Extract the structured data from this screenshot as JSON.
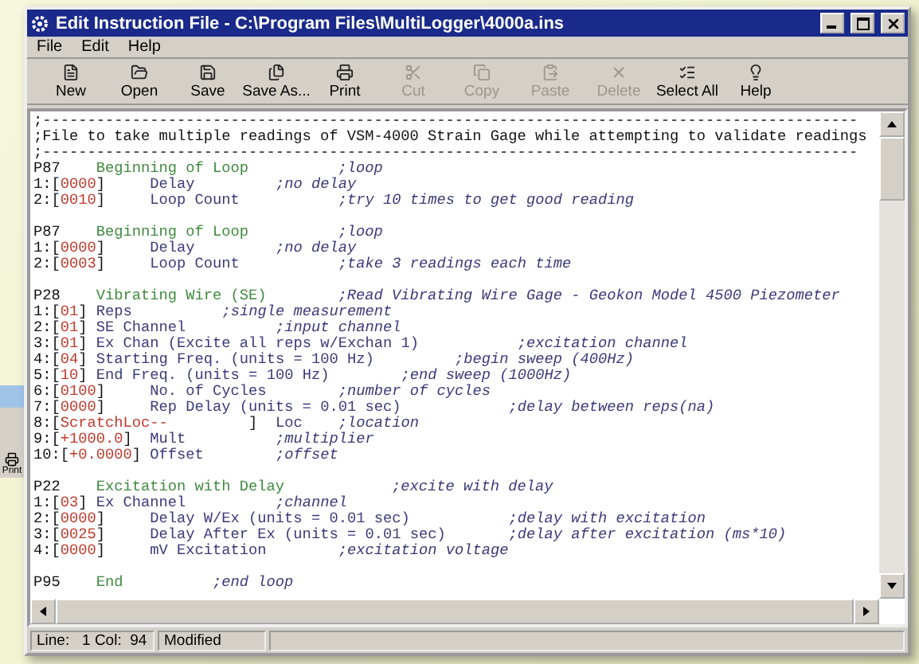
{
  "background_window": {
    "label": "Print"
  },
  "window": {
    "title": "Edit Instruction File - C:\\Program Files\\MultiLogger\\4000a.ins"
  },
  "menu": [
    "File",
    "Edit",
    "Help"
  ],
  "toolbar": [
    {
      "label": "New",
      "disabled": false
    },
    {
      "label": "Open",
      "disabled": false
    },
    {
      "label": "Save",
      "disabled": false
    },
    {
      "label": "Save As...",
      "disabled": false
    },
    {
      "label": "Print",
      "disabled": false
    },
    {
      "label": "Cut",
      "disabled": true
    },
    {
      "label": "Copy",
      "disabled": true
    },
    {
      "label": "Paste",
      "disabled": true
    },
    {
      "label": "Delete",
      "disabled": true
    },
    {
      "label": "Select All",
      "disabled": false
    },
    {
      "label": "Help",
      "disabled": false
    }
  ],
  "editor": {
    "lines": [
      {
        "kind": "code",
        "segments": [
          {
            "kind": "plain",
            "text": ";-------------------------------------------------------------------------------------------"
          }
        ]
      },
      {
        "kind": "code",
        "segments": [
          {
            "kind": "plain",
            "text": ";File to take multiple readings of VSM-4000 Strain Gage while attempting to validate readings"
          }
        ]
      },
      {
        "kind": "code",
        "segments": [
          {
            "kind": "plain",
            "text": ";-------------------------------------------------------------------------------------------"
          }
        ]
      },
      {
        "kind": "code",
        "segments": [
          {
            "kind": "plain",
            "text": "P87    "
          },
          {
            "kind": "title",
            "text": "Beginning of Loop          "
          },
          {
            "kind": "comment",
            "text": ";loop"
          }
        ]
      },
      {
        "kind": "code",
        "segments": [
          {
            "kind": "plain",
            "text": "1:["
          },
          {
            "kind": "value",
            "text": "0000"
          },
          {
            "kind": "plain",
            "text": "]     "
          },
          {
            "kind": "label",
            "text": "Delay         "
          },
          {
            "kind": "comment",
            "text": ";no delay"
          }
        ]
      },
      {
        "kind": "code",
        "segments": [
          {
            "kind": "plain",
            "text": "2:["
          },
          {
            "kind": "value",
            "text": "0010"
          },
          {
            "kind": "plain",
            "text": "]     "
          },
          {
            "kind": "label",
            "text": "Loop Count           "
          },
          {
            "kind": "comment",
            "text": ";try 10 times to get good reading"
          }
        ]
      },
      {
        "kind": "blank"
      },
      {
        "kind": "code",
        "segments": [
          {
            "kind": "plain",
            "text": "P87    "
          },
          {
            "kind": "title",
            "text": "Beginning of Loop          "
          },
          {
            "kind": "comment",
            "text": ";loop"
          }
        ]
      },
      {
        "kind": "code",
        "segments": [
          {
            "kind": "plain",
            "text": "1:["
          },
          {
            "kind": "value",
            "text": "0000"
          },
          {
            "kind": "plain",
            "text": "]     "
          },
          {
            "kind": "label",
            "text": "Delay         "
          },
          {
            "kind": "comment",
            "text": ";no delay"
          }
        ]
      },
      {
        "kind": "code",
        "segments": [
          {
            "kind": "plain",
            "text": "2:["
          },
          {
            "kind": "value",
            "text": "0003"
          },
          {
            "kind": "plain",
            "text": "]     "
          },
          {
            "kind": "label",
            "text": "Loop Count           "
          },
          {
            "kind": "comment",
            "text": ";take 3 readings each time"
          }
        ]
      },
      {
        "kind": "blank"
      },
      {
        "kind": "code",
        "segments": [
          {
            "kind": "plain",
            "text": "P28    "
          },
          {
            "kind": "title",
            "text": "Vibrating Wire (SE)        "
          },
          {
            "kind": "comment",
            "text": ";Read Vibrating Wire Gage - Geokon Model 4500 Piezometer"
          }
        ]
      },
      {
        "kind": "code",
        "segments": [
          {
            "kind": "plain",
            "text": "1:["
          },
          {
            "kind": "value",
            "text": "01"
          },
          {
            "kind": "plain",
            "text": "] "
          },
          {
            "kind": "label",
            "text": "Reps          "
          },
          {
            "kind": "comment",
            "text": ";single measurement"
          }
        ]
      },
      {
        "kind": "code",
        "segments": [
          {
            "kind": "plain",
            "text": "2:["
          },
          {
            "kind": "value",
            "text": "01"
          },
          {
            "kind": "plain",
            "text": "] "
          },
          {
            "kind": "label",
            "text": "SE Channel          "
          },
          {
            "kind": "comment",
            "text": ";input channel"
          }
        ]
      },
      {
        "kind": "code",
        "segments": [
          {
            "kind": "plain",
            "text": "3:["
          },
          {
            "kind": "value",
            "text": "01"
          },
          {
            "kind": "plain",
            "text": "] "
          },
          {
            "kind": "label",
            "text": "Ex Chan (Excite all reps w/Exchan 1)           "
          },
          {
            "kind": "comment",
            "text": ";excitation channel"
          }
        ]
      },
      {
        "kind": "code",
        "segments": [
          {
            "kind": "plain",
            "text": "4:["
          },
          {
            "kind": "value",
            "text": "04"
          },
          {
            "kind": "plain",
            "text": "] "
          },
          {
            "kind": "label",
            "text": "Starting Freq. (units = 100 Hz)         "
          },
          {
            "kind": "comment",
            "text": ";begin sweep (400Hz)"
          }
        ]
      },
      {
        "kind": "code",
        "segments": [
          {
            "kind": "plain",
            "text": "5:["
          },
          {
            "kind": "value",
            "text": "10"
          },
          {
            "kind": "plain",
            "text": "] "
          },
          {
            "kind": "label",
            "text": "End Freq. (units = 100 Hz)        "
          },
          {
            "kind": "comment",
            "text": ";end sweep (1000Hz)"
          }
        ]
      },
      {
        "kind": "code",
        "segments": [
          {
            "kind": "plain",
            "text": "6:["
          },
          {
            "kind": "value",
            "text": "0100"
          },
          {
            "kind": "plain",
            "text": "]     "
          },
          {
            "kind": "label",
            "text": "No. of Cycles        "
          },
          {
            "kind": "comment",
            "text": ";number of cycles"
          }
        ]
      },
      {
        "kind": "code",
        "segments": [
          {
            "kind": "plain",
            "text": "7:["
          },
          {
            "kind": "value",
            "text": "0000"
          },
          {
            "kind": "plain",
            "text": "]     "
          },
          {
            "kind": "label",
            "text": "Rep Delay (units = 0.01 sec)            "
          },
          {
            "kind": "comment",
            "text": ";delay between reps(na)"
          }
        ]
      },
      {
        "kind": "code",
        "segments": [
          {
            "kind": "plain",
            "text": "8:["
          },
          {
            "kind": "value",
            "text": "ScratchLoc--         "
          },
          {
            "kind": "plain",
            "text": "]  "
          },
          {
            "kind": "label",
            "text": "Loc    "
          },
          {
            "kind": "comment",
            "text": ";location"
          }
        ]
      },
      {
        "kind": "code",
        "segments": [
          {
            "kind": "plain",
            "text": "9:["
          },
          {
            "kind": "value",
            "text": "+1000.0"
          },
          {
            "kind": "plain",
            "text": "]  "
          },
          {
            "kind": "label",
            "text": "Mult          "
          },
          {
            "kind": "comment",
            "text": ";multiplier"
          }
        ]
      },
      {
        "kind": "code",
        "segments": [
          {
            "kind": "plain",
            "text": "10:["
          },
          {
            "kind": "value",
            "text": "+0.0000"
          },
          {
            "kind": "plain",
            "text": "] "
          },
          {
            "kind": "label",
            "text": "Offset        "
          },
          {
            "kind": "comment",
            "text": ";offset"
          }
        ]
      },
      {
        "kind": "blank"
      },
      {
        "kind": "code",
        "segments": [
          {
            "kind": "plain",
            "text": "P22    "
          },
          {
            "kind": "title",
            "text": "Excitation with Delay            "
          },
          {
            "kind": "comment",
            "text": ";excite with delay"
          }
        ]
      },
      {
        "kind": "code",
        "segments": [
          {
            "kind": "plain",
            "text": "1:["
          },
          {
            "kind": "value",
            "text": "03"
          },
          {
            "kind": "plain",
            "text": "] "
          },
          {
            "kind": "label",
            "text": "Ex Channel          "
          },
          {
            "kind": "comment",
            "text": ";channel"
          }
        ]
      },
      {
        "kind": "code",
        "segments": [
          {
            "kind": "plain",
            "text": "2:["
          },
          {
            "kind": "value",
            "text": "0000"
          },
          {
            "kind": "plain",
            "text": "]     "
          },
          {
            "kind": "label",
            "text": "Delay W/Ex (units = 0.01 sec)           "
          },
          {
            "kind": "comment",
            "text": ";delay with excitation"
          }
        ]
      },
      {
        "kind": "code",
        "segments": [
          {
            "kind": "plain",
            "text": "3:["
          },
          {
            "kind": "value",
            "text": "0025"
          },
          {
            "kind": "plain",
            "text": "]     "
          },
          {
            "kind": "label",
            "text": "Delay After Ex (units = 0.01 sec)       "
          },
          {
            "kind": "comment",
            "text": ";delay after excitation (ms*10)"
          }
        ]
      },
      {
        "kind": "code",
        "segments": [
          {
            "kind": "plain",
            "text": "4:["
          },
          {
            "kind": "value",
            "text": "0000"
          },
          {
            "kind": "plain",
            "text": "]     "
          },
          {
            "kind": "label",
            "text": "mV Excitation        "
          },
          {
            "kind": "comment",
            "text": ";excitation voltage"
          }
        ]
      },
      {
        "kind": "blank"
      },
      {
        "kind": "code",
        "segments": [
          {
            "kind": "plain",
            "text": "P95    "
          },
          {
            "kind": "title",
            "text": "End          "
          },
          {
            "kind": "comment",
            "text": ";end loop"
          }
        ]
      }
    ]
  },
  "status_bar": {
    "position": "Line:   1 Col:  94",
    "state": "Modified"
  }
}
